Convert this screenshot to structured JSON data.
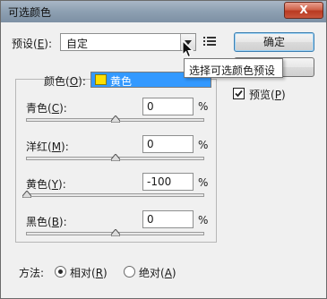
{
  "window": {
    "title": "可选颜色",
    "close_label": "X"
  },
  "preset": {
    "label": "预设(",
    "key": "E",
    "label_end": "):",
    "value": "自定"
  },
  "tooltip": "选择可选颜色预设",
  "buttons": {
    "ok": "确定",
    "cancel": ""
  },
  "preview": {
    "label": "预览(",
    "key": "P",
    "label_end": ")",
    "checked": true
  },
  "color": {
    "label": "颜色(",
    "key": "O",
    "label_end": "):",
    "value": "黄色",
    "swatch": "#ffe000",
    "highlight": "#3399ff"
  },
  "sliders": [
    {
      "label": "青色(",
      "key": "C",
      "label_end": "):",
      "value": "0",
      "unit": "%",
      "percent": 0
    },
    {
      "label": "洋红(",
      "key": "M",
      "label_end": "):",
      "value": "0",
      "unit": "%",
      "percent": 0
    },
    {
      "label": "黄色(",
      "key": "Y",
      "label_end": "):",
      "value": "-100",
      "unit": "%",
      "percent": -100
    },
    {
      "label": "黑色(",
      "key": "B",
      "label_end": "):",
      "value": "0",
      "unit": "%",
      "percent": 0
    }
  ],
  "method": {
    "label": "方法:",
    "options": [
      {
        "label": "相对(",
        "key": "R",
        "label_end": ")",
        "selected": true
      },
      {
        "label": "绝对(",
        "key": "A",
        "label_end": ")",
        "selected": false
      }
    ]
  }
}
